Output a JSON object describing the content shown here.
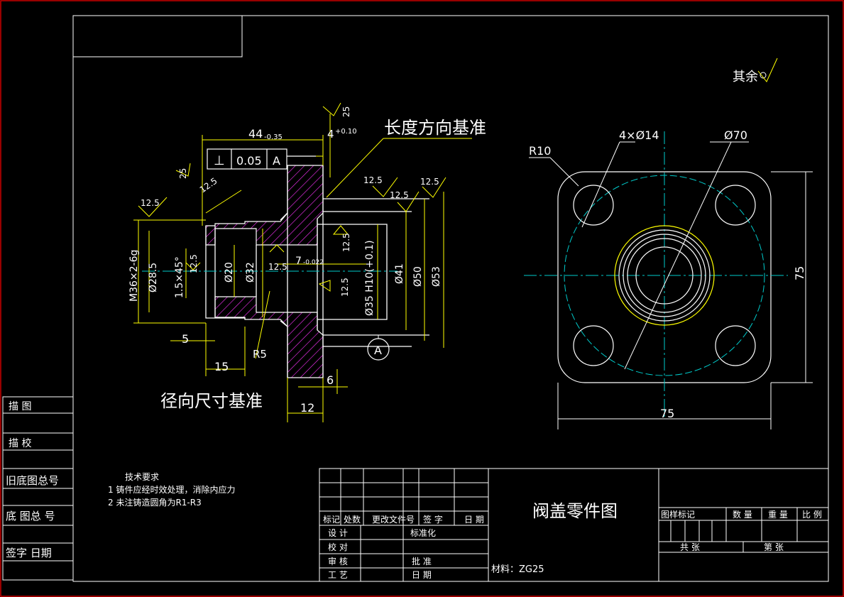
{
  "colors": {
    "background": "#000000",
    "outline": "#ffffff",
    "dimension": "#ffff00",
    "hatch": "#ff33ff",
    "centerline": "#00cccc",
    "border": "#cc0000"
  },
  "roughness_default": "其余",
  "annotations": {
    "length_datum": "长度方向基准",
    "radial_datum": "径向尺寸基准"
  },
  "section_view": {
    "dims": {
      "d44": "44",
      "d44_tol": "-0.35",
      "d4": "4",
      "d4_tol": "+0.10",
      "d5": "5",
      "d15": "15",
      "d12": "12",
      "d6": "6",
      "r5": "R5",
      "m36": "M36×2-6g",
      "phi285": "Ø28.5",
      "phi20": "Ø20",
      "phi32": "Ø32",
      "phi35": "Ø35 H10(+0.1)",
      "phi41": "Ø41",
      "phi50": "Ø50",
      "phi53": "Ø53",
      "d7": "7",
      "d7_tol": "-0.022",
      "chamfer": "1.5×45°"
    },
    "roughness": [
      "25",
      "12.5",
      "12.5",
      "12.5",
      "12.5",
      "12.5",
      "12.5",
      "12.5",
      "25",
      "12.5",
      "12.5"
    ],
    "tolerance_frame": {
      "symbol": "⊥",
      "value": "0.05",
      "datum": "A"
    },
    "datum_label": "A"
  },
  "plan_view": {
    "r10": "R10",
    "holes": "4×Ø14",
    "phi70": "Ø70",
    "width": "75",
    "height": "75"
  },
  "tech_requirements": {
    "title": "技术要求",
    "items": [
      "1  铸件应经时效处理，消除内应力",
      "2  未注铸造圆角为R1-R3"
    ]
  },
  "side_table": [
    "描    图",
    "描    校",
    "旧底图总号",
    "底 图总 号",
    "签字  日期"
  ],
  "title_block": {
    "part_name": "阀盖零件图",
    "material": "材料：ZG25",
    "revision_headers": [
      "标记",
      "处数",
      "更改文件号",
      "签 字",
      "日 期"
    ],
    "rows_left": [
      "设 计",
      "校 对",
      "审 核",
      "工 艺"
    ],
    "rows_mid": [
      "标准化",
      "",
      "批 准",
      "日 期"
    ],
    "right_headers": [
      "图样标记",
      "数 量",
      "重 量",
      "比 例"
    ],
    "sheet_total": "共    张",
    "sheet_no": "第    张"
  }
}
